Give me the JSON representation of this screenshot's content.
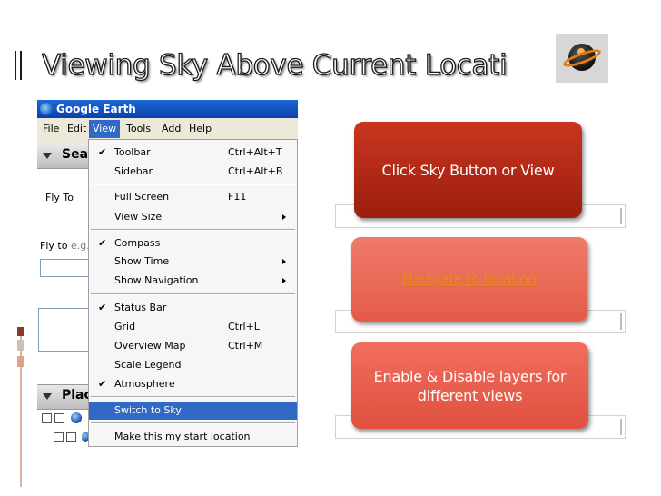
{
  "slide": {
    "title": "Viewing Sky Above Current Locati",
    "icon": "sky-planet-icon"
  },
  "window": {
    "title": "Google Earth",
    "menubar": [
      "File",
      "Edit",
      "View",
      "Tools",
      "Add",
      "Help"
    ],
    "search_header": "Sear",
    "fly_to_tab": "Fly To",
    "fly_to_label": "Fly to",
    "fly_to_hint": "e.g.,",
    "places_header": "Plac"
  },
  "view_menu": {
    "items": [
      {
        "label": "Toolbar",
        "shortcut": "Ctrl+Alt+T",
        "checked": true
      },
      {
        "label": "Sidebar",
        "shortcut": "Ctrl+Alt+B",
        "checked": false
      },
      {
        "label": "Full Screen",
        "shortcut": "F11",
        "checked": false
      },
      {
        "label": "View Size",
        "shortcut": "",
        "submenu": true
      },
      {
        "label": "Compass",
        "shortcut": "",
        "checked": true
      },
      {
        "label": "Show Time",
        "shortcut": "",
        "submenu": true
      },
      {
        "label": "Show Navigation",
        "shortcut": "",
        "submenu": true
      },
      {
        "label": "Status Bar",
        "shortcut": "",
        "checked": true
      },
      {
        "label": "Grid",
        "shortcut": "Ctrl+L",
        "checked": false
      },
      {
        "label": "Overview Map",
        "shortcut": "Ctrl+M",
        "checked": false
      },
      {
        "label": "Scale Legend",
        "shortcut": "",
        "checked": false
      },
      {
        "label": "Atmosphere",
        "shortcut": "",
        "checked": true
      },
      {
        "label": "Switch to Sky",
        "shortcut": "",
        "highlighted": true
      },
      {
        "label": "Make this my start location",
        "shortcut": ""
      }
    ]
  },
  "steps": [
    {
      "text": "Click Sky Button or View"
    },
    {
      "text": "Navigate to location"
    },
    {
      "text": "Enable & Disable layers for different views"
    }
  ],
  "colors": {
    "step1": "#b42a15",
    "step2": "#ea6a57",
    "step3": "#e85f4d",
    "step2_link": "#e8891e",
    "menu_highlight": "#316ac5"
  }
}
